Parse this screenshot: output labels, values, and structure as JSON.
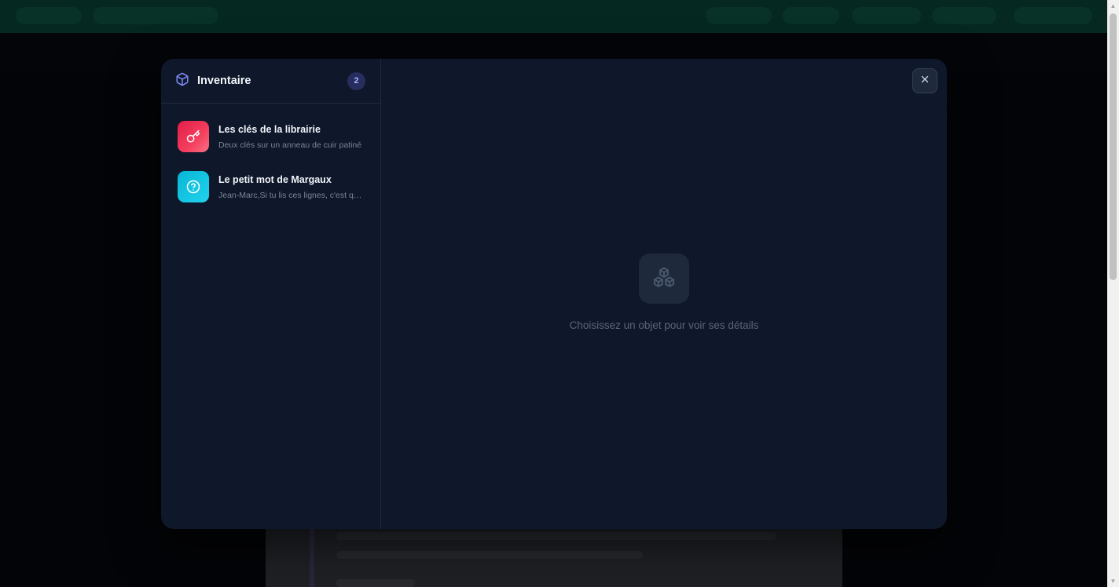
{
  "inventory": {
    "title": "Inventaire",
    "count": "2",
    "icon": "cube-icon",
    "items": [
      {
        "title": "Les clés de la librairie",
        "description": "Deux clés sur un anneau de cuir patiné",
        "icon": "key-icon",
        "color": "#f43f5e"
      },
      {
        "title": "Le petit mot de Margaux",
        "description": "Jean-Marc,Si tu lis ces lignes, c'est que...",
        "icon": "question-circle-icon",
        "color": "#22d3ee"
      }
    ],
    "empty_state": {
      "icon": "cubes-icon",
      "text": "Choisissez un objet pour voir ses détails"
    },
    "close_icon": "close-icon"
  },
  "colors": {
    "modal_bg": "#0f172a",
    "accent": "#818cf8",
    "badge_bg": "#272d5e"
  }
}
